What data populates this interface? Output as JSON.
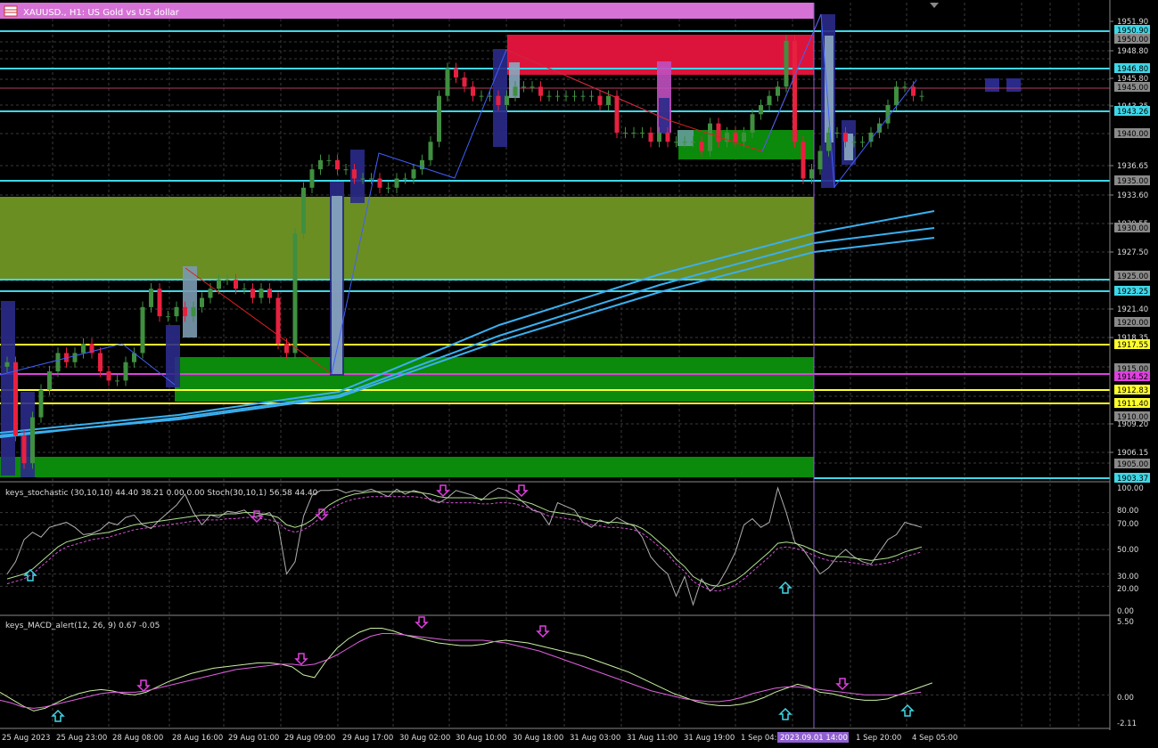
{
  "window": {
    "title": "XAUUSD., H1:  US Gold vs US dollar",
    "icon": "chart-window-icon"
  },
  "colors": {
    "background": "#000000",
    "bull": "#3f8f3f",
    "bear": "#e8203f",
    "grid": "#3a3a3a",
    "level_cyan": "#3fd7e8",
    "level_yellow": "#ffff2e",
    "level_magenta": "#e040e0",
    "zone_crimson": "#dc143c",
    "zone_olive": "#6b8e23",
    "zone_green": "#0b8a0b",
    "ma_blue": "#3ab0f0",
    "stoch_main": "#b0b0b0",
    "stoch_signal": "#b0e090",
    "macd_main": "#c8f0a0",
    "macd_signal": "#e060e0"
  },
  "price_axis": {
    "labels": [
      "1951.90",
      "1948.80",
      "1945.80",
      "1943.35",
      "1936.65",
      "1933.60",
      "1930.55",
      "1927.50",
      "1921.40",
      "1918.35",
      "1909.20",
      "1906.15"
    ],
    "boxed": [
      {
        "text": "1950.90",
        "style": "cyan"
      },
      {
        "text": "1950.00",
        "style": "gray"
      },
      {
        "text": "1946.80",
        "style": "cyan"
      },
      {
        "text": "1945.00",
        "style": "gray"
      },
      {
        "text": "1943.26",
        "style": "cyan"
      },
      {
        "text": "1940.00",
        "style": "gray"
      },
      {
        "text": "1935.00",
        "style": "gray"
      },
      {
        "text": "1930.00",
        "style": "gray"
      },
      {
        "text": "1925.00",
        "style": "gray"
      },
      {
        "text": "1923.25",
        "style": "cyan"
      },
      {
        "text": "1920.00",
        "style": "gray"
      },
      {
        "text": "1917.55",
        "style": "yellow"
      },
      {
        "text": "1915.00",
        "style": "gray"
      },
      {
        "text": "1914.52",
        "style": "magenta"
      },
      {
        "text": "1912.83",
        "style": "yellow"
      },
      {
        "text": "1911.40",
        "style": "yellow"
      },
      {
        "text": "1910.00",
        "style": "gray"
      },
      {
        "text": "1905.00",
        "style": "gray"
      },
      {
        "text": "1903.37",
        "style": "cyan"
      }
    ]
  },
  "stoch_panel": {
    "label": "keys_stochastic (30,10,10) 44.40 38.21 0.00 0.00 Stoch(30,10,1) 56.58 44.40",
    "axis": [
      "100.00",
      "80.00",
      "70.00",
      "50.00",
      "30.00",
      "20.00",
      "0.00"
    ]
  },
  "macd_panel": {
    "label": "keys_MACD_alert(12, 26, 9) 0.67 -0.05",
    "axis": [
      "5.50",
      "0.00",
      "-2.11"
    ]
  },
  "time_axis": {
    "labels": [
      "25 Aug 2023",
      "25 Aug 23:00",
      "28 Aug 08:00",
      "28 Aug 16:00",
      "29 Aug 01:00",
      "29 Aug 09:00",
      "29 Aug 17:00",
      "30 Aug 02:00",
      "30 Aug 10:00",
      "30 Aug 18:00",
      "31 Aug 03:00",
      "31 Aug 11:00",
      "31 Aug 19:00",
      "1 Sep 04:00",
      "1 Sep 20:00",
      "4 Sep 05:00"
    ],
    "cursor_label": "2023.09.01 14:00"
  },
  "chart_data": {
    "type": "candlestick",
    "symbol": "XAUUSD.",
    "timeframe": "H1",
    "price_range": [
      1903.37,
      1953.5
    ],
    "closes": [
      1916,
      1908,
      1905,
      1910,
      1913,
      1915,
      1917,
      1916,
      1917,
      1918,
      1917,
      1915,
      1914,
      1914,
      1916,
      1917,
      1922,
      1924,
      1921,
      1921,
      1922,
      1921,
      1922,
      1923,
      1924,
      1925,
      1925,
      1924,
      1924,
      1923,
      1924,
      1923,
      1918,
      1917,
      1930,
      1935,
      1937,
      1938,
      1938,
      1937,
      1937,
      1936,
      1936,
      1936,
      1935,
      1935,
      1936,
      1936,
      1937,
      1938,
      1940,
      1945,
      1948,
      1947,
      1946,
      1945,
      1945,
      1945,
      1944,
      1945,
      1946,
      1946,
      1946,
      1945,
      1945,
      1945,
      1945,
      1945,
      1945,
      1945,
      1944,
      1945,
      1941,
      1941,
      1941,
      1941,
      1940,
      1941,
      1940,
      1940,
      1940,
      1940,
      1939,
      1942,
      1940,
      1941,
      1940,
      1941,
      1943,
      1944,
      1945,
      1946,
      1951,
      1940,
      1936,
      1937,
      1939,
      1941,
      1941,
      1940,
      1940,
      1940,
      1941,
      1942,
      1944,
      1946,
      1946,
      1945,
      1945
    ],
    "ma_levels": [
      1908,
      1930.5
    ],
    "levels": [
      1950.9,
      1946.8,
      1943.26,
      1935.0,
      1923.25,
      1917.55,
      1914.52,
      1912.83,
      1911.4,
      1903.37
    ],
    "stoch_range": [
      0,
      100
    ],
    "macd_range": [
      -2.11,
      5.5
    ]
  }
}
